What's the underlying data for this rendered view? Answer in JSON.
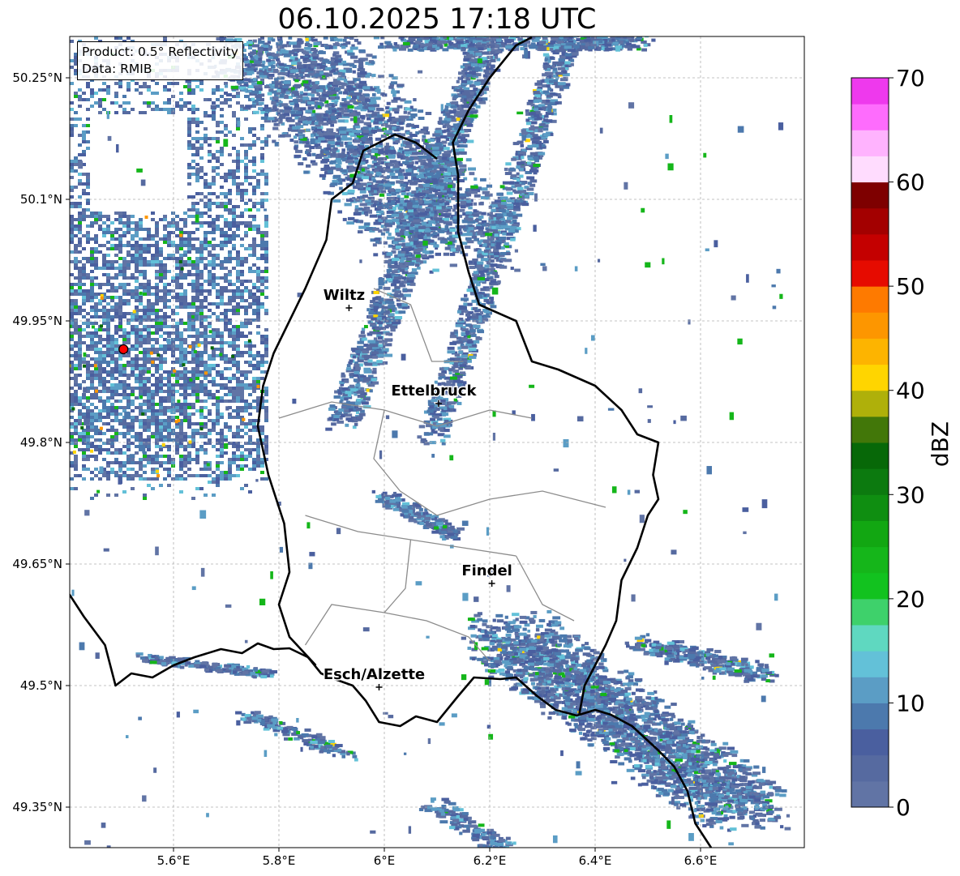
{
  "title": "06.10.2025 17:18 UTC",
  "info": {
    "product": "Product: 0.5° Reflectivity",
    "data": "Data: RMIB"
  },
  "map": {
    "lon_range": [
      5.4,
      6.8
    ],
    "lat_range": [
      49.3,
      50.3
    ],
    "lon_ticks": [
      {
        "value": 5.6,
        "label": "5.6°E"
      },
      {
        "value": 5.8,
        "label": "5.8°E"
      },
      {
        "value": 6.0,
        "label": "6°E"
      },
      {
        "value": 6.2,
        "label": "6.2°E"
      },
      {
        "value": 6.4,
        "label": "6.4°E"
      },
      {
        "value": 6.6,
        "label": "6.6°E"
      }
    ],
    "lat_ticks": [
      {
        "value": 50.25,
        "label": "50.25°N"
      },
      {
        "value": 50.1,
        "label": "50.1°N"
      },
      {
        "value": 49.95,
        "label": "49.95°N"
      },
      {
        "value": 49.8,
        "label": "49.8°N"
      },
      {
        "value": 49.65,
        "label": "49.65°N"
      },
      {
        "value": 49.5,
        "label": "49.5°N"
      },
      {
        "value": 49.35,
        "label": "49.35°N"
      }
    ],
    "grid": true,
    "radar_site": {
      "lon": 5.505,
      "lat": 49.915
    },
    "cities": [
      {
        "name": "Wiltz",
        "lon": 5.933,
        "lat": 49.966
      },
      {
        "name": "Ettelbruck",
        "lon": 6.103,
        "lat": 49.848
      },
      {
        "name": "Findel",
        "lon": 6.204,
        "lat": 49.626
      },
      {
        "name": "Esch/Alzette",
        "lon": 5.99,
        "lat": 49.498
      }
    ],
    "border": [
      [
        5.4,
        49.615
      ],
      [
        5.43,
        49.585
      ],
      [
        5.47,
        49.55
      ],
      [
        5.49,
        49.5
      ],
      [
        5.52,
        49.515
      ],
      [
        5.56,
        49.51
      ],
      [
        5.6,
        49.525
      ],
      [
        5.64,
        49.535
      ],
      [
        5.69,
        49.545
      ],
      [
        5.73,
        49.54
      ],
      [
        5.76,
        49.552
      ],
      [
        5.79,
        49.545
      ],
      [
        5.82,
        49.546
      ],
      [
        5.855,
        49.535
      ],
      [
        5.88,
        49.515
      ],
      [
        5.91,
        49.507
      ],
      [
        5.94,
        49.5
      ],
      [
        5.965,
        49.481
      ],
      [
        5.99,
        49.455
      ],
      [
        6.03,
        49.45
      ],
      [
        6.06,
        49.462
      ],
      [
        6.1,
        49.455
      ],
      [
        6.14,
        49.487
      ],
      [
        6.17,
        49.51
      ],
      [
        6.22,
        49.508
      ],
      [
        6.25,
        49.51
      ],
      [
        6.29,
        49.487
      ],
      [
        6.325,
        49.47
      ],
      [
        6.365,
        49.463
      ],
      [
        6.4,
        49.47
      ],
      [
        6.43,
        49.464
      ],
      [
        6.47,
        49.45
      ],
      [
        6.52,
        49.42
      ],
      [
        6.55,
        49.4
      ],
      [
        6.575,
        49.37
      ],
      [
        6.59,
        49.33
      ],
      [
        6.62,
        49.3
      ]
    ],
    "border_east": [
      [
        6.37,
        49.465
      ],
      [
        6.38,
        49.5
      ],
      [
        6.42,
        49.55
      ],
      [
        6.44,
        49.58
      ],
      [
        6.45,
        49.63
      ],
      [
        6.48,
        49.67
      ],
      [
        6.5,
        49.71
      ],
      [
        6.52,
        49.73
      ],
      [
        6.51,
        49.76
      ],
      [
        6.52,
        49.8
      ],
      [
        6.48,
        49.81
      ],
      [
        6.45,
        49.84
      ],
      [
        6.4,
        49.87
      ],
      [
        6.33,
        49.89
      ],
      [
        6.28,
        49.9
      ],
      [
        6.25,
        49.95
      ],
      [
        6.18,
        49.97
      ],
      [
        6.16,
        50.01
      ],
      [
        6.14,
        50.06
      ],
      [
        6.14,
        50.13
      ],
      [
        6.13,
        50.17
      ],
      [
        6.16,
        50.21
      ],
      [
        6.2,
        50.25
      ],
      [
        6.25,
        50.29
      ],
      [
        6.28,
        50.3
      ]
    ],
    "border_west": [
      [
        5.87,
        49.525
      ],
      [
        5.82,
        49.56
      ],
      [
        5.8,
        49.6
      ],
      [
        5.82,
        49.64
      ],
      [
        5.81,
        49.7
      ],
      [
        5.78,
        49.76
      ],
      [
        5.76,
        49.82
      ],
      [
        5.77,
        49.87
      ],
      [
        5.79,
        49.91
      ],
      [
        5.82,
        49.95
      ],
      [
        5.85,
        49.99
      ],
      [
        5.89,
        50.05
      ],
      [
        5.9,
        50.1
      ],
      [
        5.94,
        50.12
      ],
      [
        5.96,
        50.16
      ],
      [
        6.02,
        50.18
      ],
      [
        6.06,
        50.17
      ],
      [
        6.1,
        50.15
      ]
    ],
    "district_lines": [
      [
        [
          5.98,
          49.99
        ],
        [
          6.05,
          49.97
        ],
        [
          6.09,
          49.9
        ],
        [
          6.15,
          49.9
        ]
      ],
      [
        [
          5.8,
          49.83
        ],
        [
          5.9,
          49.85
        ],
        [
          6.0,
          49.84
        ],
        [
          6.1,
          49.82
        ],
        [
          6.2,
          49.84
        ],
        [
          6.28,
          49.83
        ]
      ],
      [
        [
          6.0,
          49.84
        ],
        [
          5.98,
          49.78
        ],
        [
          6.03,
          49.74
        ],
        [
          6.1,
          49.71
        ],
        [
          6.2,
          49.73
        ],
        [
          6.3,
          49.74
        ],
        [
          6.42,
          49.72
        ]
      ],
      [
        [
          5.85,
          49.71
        ],
        [
          5.95,
          49.69
        ],
        [
          6.05,
          49.68
        ],
        [
          6.15,
          49.67
        ],
        [
          6.25,
          49.66
        ]
      ],
      [
        [
          5.85,
          49.55
        ],
        [
          5.9,
          49.6
        ],
        [
          6.0,
          49.59
        ],
        [
          6.08,
          49.58
        ],
        [
          6.16,
          49.56
        ],
        [
          6.2,
          49.53
        ]
      ],
      [
        [
          6.05,
          49.68
        ],
        [
          6.04,
          49.62
        ],
        [
          6.0,
          49.59
        ]
      ],
      [
        [
          6.25,
          49.66
        ],
        [
          6.3,
          49.6
        ],
        [
          6.36,
          49.58
        ]
      ]
    ]
  },
  "colorbar": {
    "label": "dBZ",
    "min": 0,
    "max": 70,
    "step": 2.5,
    "tick_values": [
      0,
      10,
      20,
      30,
      40,
      50,
      60,
      70
    ],
    "colors": [
      "#6174a5",
      "#566aa0",
      "#4a5f9f",
      "#4c79ad",
      "#5b9dc5",
      "#63c1d8",
      "#5fd8c0",
      "#3ed16b",
      "#12c21f",
      "#15b61a",
      "#12a712",
      "#0f8e11",
      "#0c7a0f",
      "#076808",
      "#427709",
      "#afb00a",
      "#ffd500",
      "#fdb400",
      "#fd9600",
      "#fe7a00",
      "#e60b00",
      "#c40000",
      "#a30000",
      "#7e0000",
      "#ffdcfe",
      "#ffb3fe",
      "#fe6cfd",
      "#ee39ed"
    ]
  }
}
